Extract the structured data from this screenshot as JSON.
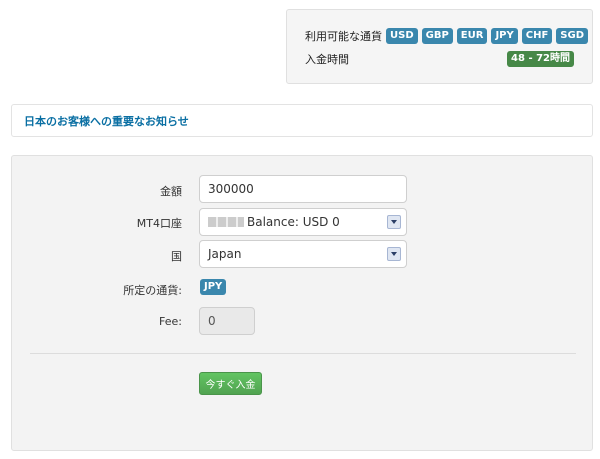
{
  "info": {
    "currencies_label": "利用可能な通貨",
    "currencies": [
      "USD",
      "GBP",
      "EUR",
      "JPY",
      "CHF",
      "SGD"
    ],
    "deposit_time_label": "入金時間",
    "deposit_time_value": "48 - 72時間"
  },
  "notice": {
    "title": "日本のお客様への重要なお知らせ"
  },
  "form": {
    "amount_label": "金額",
    "amount_value": "300000",
    "account_label": "MT4口座",
    "account_value": "Balance: USD 0",
    "country_label": "国",
    "country_value": "Japan",
    "currency_label": "所定の通貨:",
    "currency_value": "JPY",
    "fee_label": "Fee:",
    "fee_value": "0",
    "submit_label": "今すぐ入金"
  },
  "colors": {
    "badge_blue": "#3a87ad",
    "badge_green": "#468847",
    "notice_title": "#0a6fa3",
    "submit_button": "#51a351"
  }
}
